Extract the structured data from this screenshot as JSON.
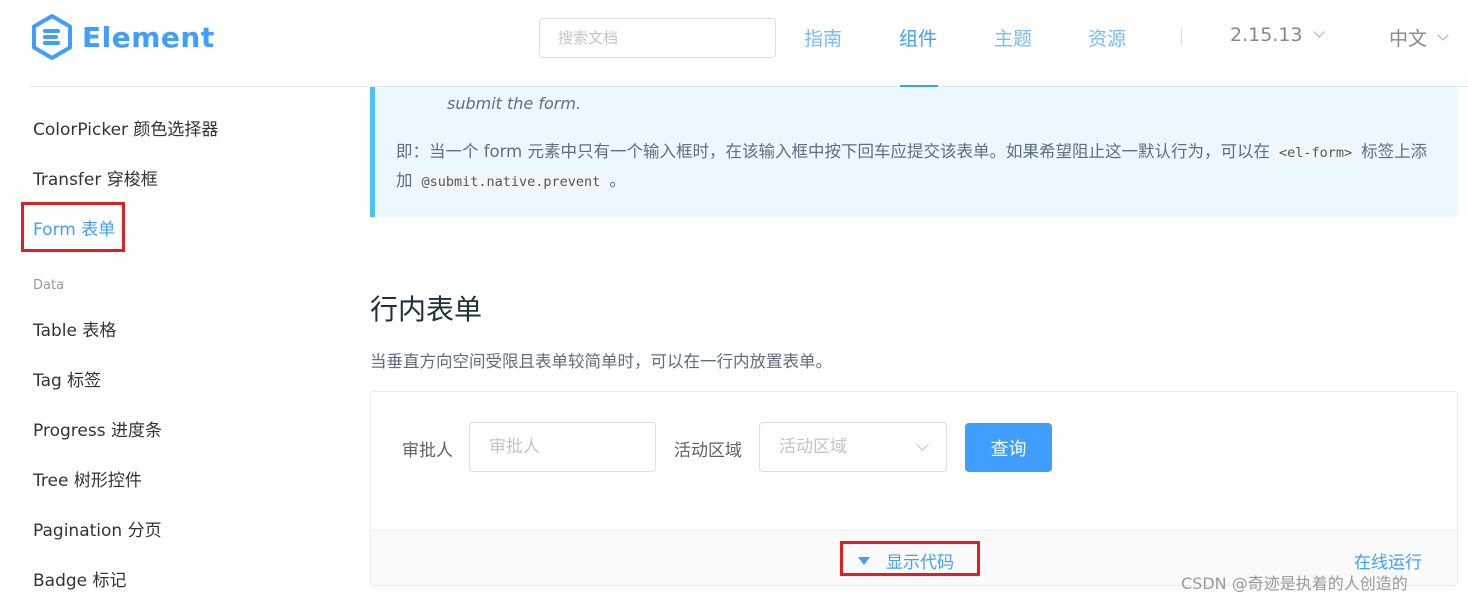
{
  "header": {
    "logo_text": "Element",
    "search_placeholder": "搜索文档",
    "nav": [
      "指南",
      "组件",
      "主题",
      "资源"
    ],
    "version": "2.15.13",
    "language": "中文"
  },
  "sidebar": {
    "items_top": [
      "ColorPicker 颜色选择器",
      "Transfer 穿梭框",
      "Form 表单"
    ],
    "group_data": "Data",
    "items_data": [
      "Table 表格",
      "Tag 标签",
      "Progress 进度条",
      "Tree 树形控件",
      "Pagination 分页",
      "Badge 标记"
    ]
  },
  "tip": {
    "en_line": "submit the form.",
    "zh_part1": "即：当一个 form 元素中只有一个输入框时，在该输入框中按下回车应提交该表单。如果希望阻止这一默认行为，可以在",
    "code1": "<el-form>",
    "zh_part2": "标签上添加",
    "code2": "@submit.native.prevent",
    "zh_part3": "。"
  },
  "section": {
    "title": "行内表单",
    "desc": "当垂直方向空间受限且表单较简单时，可以在一行内放置表单。"
  },
  "demo": {
    "label_approver": "审批人",
    "placeholder_approver": "审批人",
    "label_region": "活动区域",
    "placeholder_region": "活动区域",
    "btn_query": "查询",
    "show_code": "显示代码",
    "online_run": "在线运行"
  },
  "watermark": "CSDN @奇迹是执着的人创造的",
  "colors": {
    "primary": "#409eff",
    "highlight": "#e02020"
  }
}
